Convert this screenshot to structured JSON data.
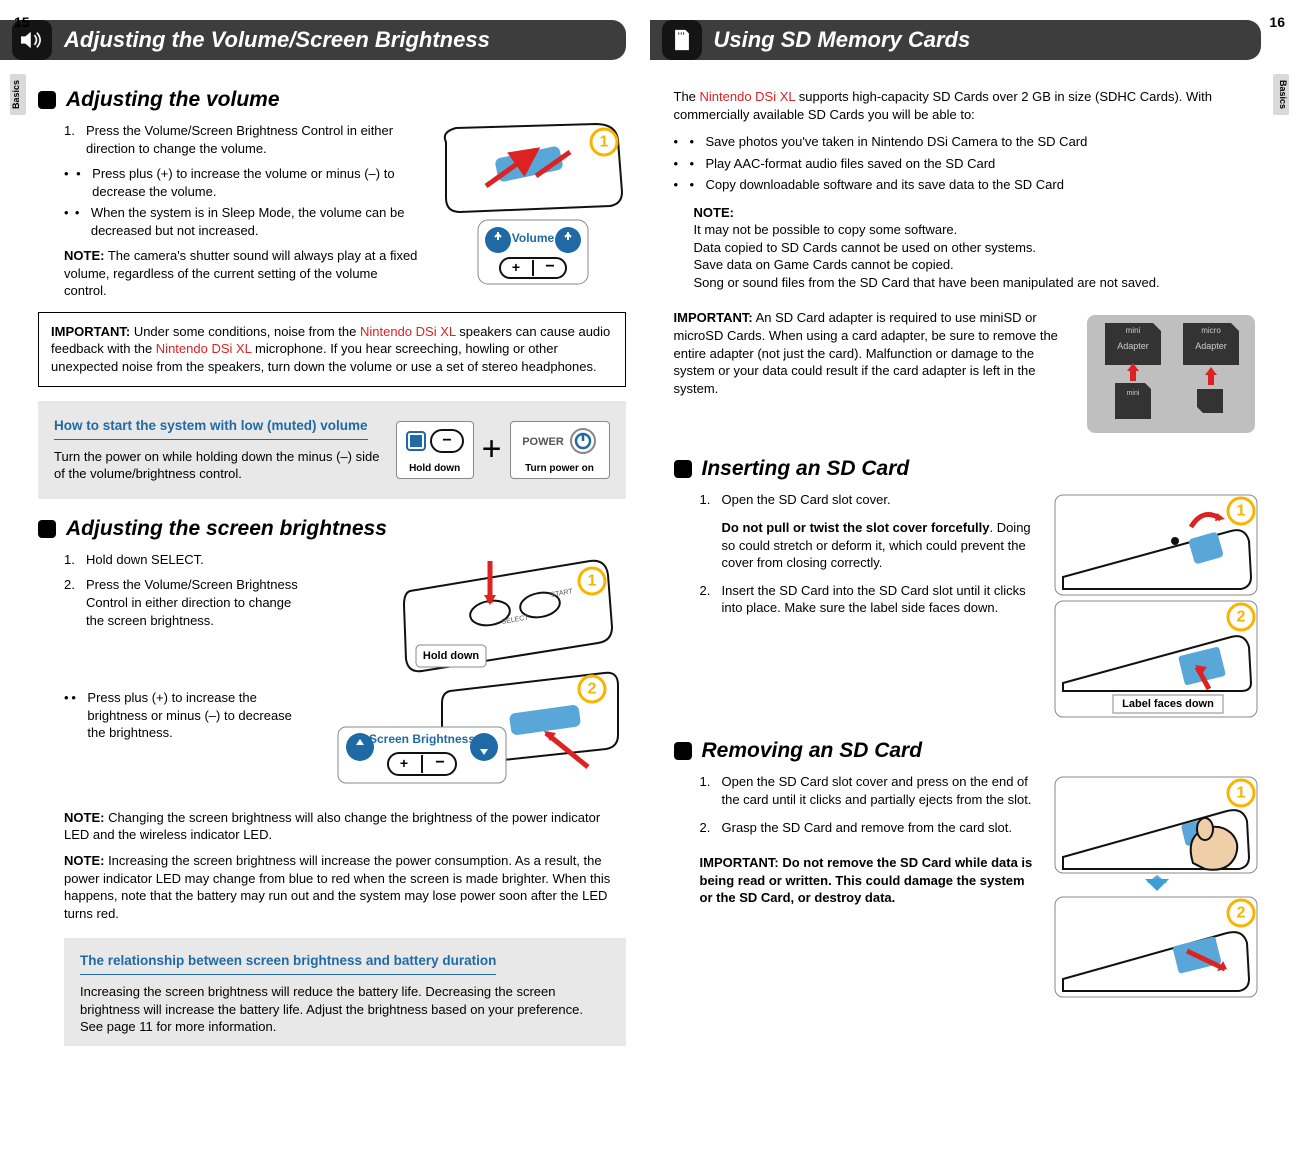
{
  "left": {
    "pageNum": "15",
    "tab": "Basics",
    "title": "Adjusting the Volume/Screen Brightness",
    "sec1": "Adjusting the volume",
    "s1_step1": "Press the Volume/Screen Brightness Control in either direction to change the volume.",
    "s1_b1": "Press plus (+) to increase the volume or minus (–) to decrease the volume.",
    "s1_b2": "When the system is in Sleep Mode, the volume can be decreased but not increased.",
    "s1_noteLabel": "NOTE:",
    "s1_note": " The camera's shutter sound will always play at a fixed volume, regardless of the current setting of the volume control.",
    "imp1_label": "IMPORTANT:",
    "imp1_a": " Under some conditions, noise from the ",
    "imp1_red1": "Nintendo DSi XL",
    "imp1_b": " speakers can cause audio feedback with the ",
    "imp1_red2": "Nintendo DSi XL",
    "imp1_c": " microphone. If you hear screeching, howling or other unexpected noise from the speakers, turn down the volume or use a set of stereo headphones.",
    "muted_head": "How to start the system with low (muted) volume",
    "muted_txt": "Turn the power on while holding down the minus (–) side of the volume/brightness control.",
    "hold_down": "Hold down",
    "power_label": "POWER",
    "turn_on": "Turn power on",
    "volume_lbl": "Volume",
    "sec2": "Adjusting the screen brightness",
    "s2_step1": "Hold down SELECT.",
    "s2_step2": "Press the Volume/Screen Brightness Control in either direction to change the screen brightness.",
    "s2_b1": "Press plus (+) to increase the brightness or minus (–) to decrease the brightness.",
    "brightness_lbl": "Screen Brightness",
    "s2_note1_label": "NOTE:",
    "s2_note1": " Changing the screen brightness will also change the brightness of the power indicator LED and the wireless indicator LED.",
    "s2_note2_label": "NOTE:",
    "s2_note2": " Increasing the screen brightness will increase the power consumption. As a result, the power indicator LED may change from blue to red when the screen is made brighter. When this happens, note that the battery may run out and the system may lose power soon after the LED turns red.",
    "batt_head": "The relationship between screen brightness and battery duration",
    "batt_txt": "Increasing the screen brightness will reduce the battery life. Decreasing the screen brightness will increase the battery life. Adjust the brightness based on your preference. See page 11 for more information."
  },
  "right": {
    "pageNum": "16",
    "tab": "Basics",
    "title": "Using SD Memory Cards",
    "intro_a": "The ",
    "intro_red": "Nintendo DSi XL",
    "intro_b": " supports high-capacity SD Cards over 2 GB in size (SDHC Cards). With commercially available SD Cards you will be able to:",
    "i_b1": "Save photos you've taken in Nintendo DSi Camera to the SD Card",
    "i_b2": "Play AAC-format audio files saved on the SD Card",
    "i_b3": "Copy downloadable software and its save data to the SD Card",
    "noteLabel": "NOTE:",
    "n1": "It may not be possible to copy some software.",
    "n2": "Data copied to SD Cards cannot be used on other systems.",
    "n3": "Save data on Game Cards cannot be copied.",
    "n4": "Song or sound files from the SD Card that have been manipulated are not saved.",
    "imp_label": "IMPORTANT:",
    "imp_txt": " An SD Card adapter is required to use miniSD or microSD Cards. When using a card adapter, be sure to remove the entire adapter (not just the card). Malfunction or damage to the system or your data could result if the card adapter is left in the system.",
    "adapter_mini": "Adapter",
    "adapter_micro": "Adapter",
    "sec2": "Inserting an SD Card",
    "ins_s1": "Open the SD Card slot cover.",
    "ins_s1b_bold": "Do not pull or twist the slot cover forcefully",
    "ins_s1b": ". Doing so could stretch or deform it, which could prevent the cover from closing correctly.",
    "ins_s2": "Insert the SD Card into the SD Card slot until it clicks into place.  Make sure the label side faces down.",
    "label_down": "Label faces down",
    "sec3": "Removing an SD Card",
    "rem_s1": "Open the SD Card slot cover and press on the end of the card until it clicks and partially ejects from the slot.",
    "rem_s2": "Grasp the SD Card and remove from the card slot.",
    "rem_imp_label": "IMPORTANT: ",
    "rem_imp": "Do not remove the SD Card while data is being read or written. This could damage the system or the SD Card, or destroy data."
  }
}
